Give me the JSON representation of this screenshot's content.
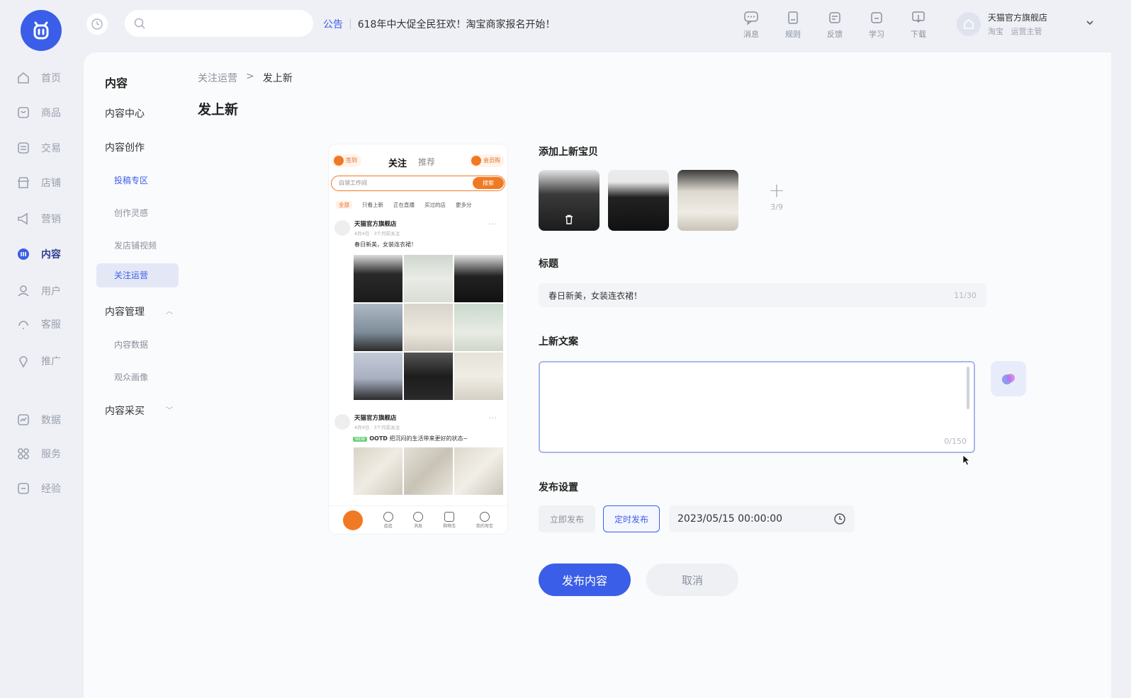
{
  "app": {
    "search": {
      "placeholder": ""
    },
    "notice": {
      "tag": "公告",
      "text": "618年中大促全民狂欢！淘宝商家报名开始！"
    },
    "top_tools": [
      {
        "icon": "message-icon",
        "label": "消息"
      },
      {
        "icon": "rules-icon",
        "label": "规则"
      },
      {
        "icon": "feedback-icon",
        "label": "反馈"
      },
      {
        "icon": "learn-icon",
        "label": "学习"
      },
      {
        "icon": "download-icon",
        "label": "下载"
      }
    ],
    "store": {
      "name": "天猫官方旗舰店",
      "platform": "淘宝",
      "role": "运营主管"
    },
    "accent": "#3b5ee8"
  },
  "rail": {
    "items": [
      {
        "label": "首页",
        "icon": "home-icon"
      },
      {
        "label": "商品",
        "icon": "goods-icon"
      },
      {
        "label": "交易",
        "icon": "trade-icon"
      },
      {
        "label": "店铺",
        "icon": "shop-icon"
      },
      {
        "label": "营销",
        "icon": "megaphone-icon"
      },
      {
        "label": "内容",
        "icon": "content-icon",
        "active": true
      },
      {
        "label": "用户",
        "icon": "user-icon"
      },
      {
        "label": "客服",
        "icon": "service-icon"
      },
      {
        "label": "推广",
        "icon": "promote-icon"
      },
      {
        "label": "数据",
        "icon": "data-icon"
      },
      {
        "label": "服务",
        "icon": "apps-icon"
      },
      {
        "label": "经验",
        "icon": "experience-icon"
      }
    ]
  },
  "subnav": {
    "title": "内容",
    "content_center": "内容中心",
    "creation": "内容创作",
    "creation_children": [
      "投稿专区",
      "创作灵感",
      "发店铺视频",
      "关注运营"
    ],
    "management": "内容管理",
    "management_children": [
      "内容数据",
      "观众画像"
    ],
    "purchase": "内容采买"
  },
  "breadcrumb": {
    "parent": "关注运营",
    "current": "发上新"
  },
  "page_title": "发上新",
  "preview": {
    "badge_left": "签到",
    "tab_follow": "关注",
    "tab_recommend": "推荐",
    "badge_right": "会员购",
    "search_placeholder": "白领工作间",
    "search_button": "搜索",
    "categories": [
      "全部",
      "只看上新",
      "正在直播",
      "买过的店",
      "更多分"
    ],
    "post1": {
      "shop": "天猫官方旗舰店",
      "time": "4月4日 · 3个月前关注",
      "text": "春日新美，女装连衣裙！"
    },
    "post2": {
      "shop": "天猫官方旗舰店",
      "time": "4月4日 · 3个月前关注",
      "tag": "OOTD",
      "text": "把沉闷的生活带来更好的状态~"
    },
    "bottom_tabs": [
      "逛逛",
      "消息",
      "购物车",
      "我的淘宝"
    ]
  },
  "form": {
    "add_goods_label": "添加上新宝贝",
    "goods_count": "3/9",
    "title_label": "标题",
    "title_value": "春日新美，女装连衣裙！",
    "title_count": "11/30",
    "copy_label": "上新文案",
    "copy_value": "",
    "copy_count": "0/150",
    "publish_label": "发布设置",
    "publish_now": "立即发布",
    "publish_scheduled": "定时发布",
    "publish_mode": "定时发布",
    "datetime": "2023/05/15 00:00:00",
    "submit": "发布内容",
    "cancel": "取消"
  }
}
